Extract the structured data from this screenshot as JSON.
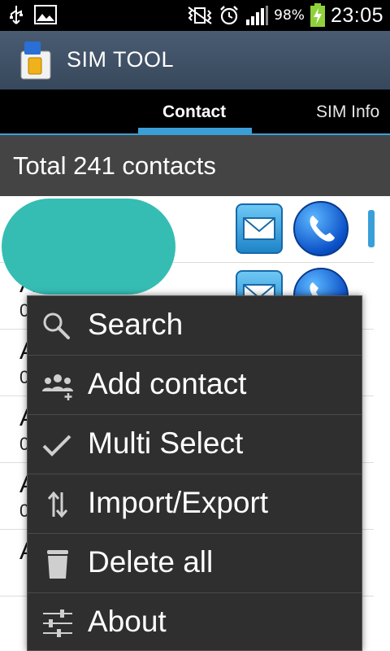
{
  "status_bar": {
    "battery_percent": "98%",
    "time": "23:05"
  },
  "app": {
    "title": "SIM TOOL"
  },
  "tabs": [
    {
      "label": "Contact",
      "selected": true
    },
    {
      "label": "SIM Info",
      "selected": false
    }
  ],
  "contacts": {
    "total_label": "Total 241 contacts",
    "rows": [
      {
        "name": "",
        "number": ""
      },
      {
        "name": "A",
        "number": "0"
      },
      {
        "name": "A",
        "number": "0"
      },
      {
        "name": "A",
        "number": "0"
      },
      {
        "name": "A",
        "number": "0"
      },
      {
        "name": "A",
        "number": ""
      }
    ]
  },
  "menu": {
    "items": [
      {
        "label": "Search",
        "icon": "search-icon"
      },
      {
        "label": "Add contact",
        "icon": "add-contact-icon"
      },
      {
        "label": "Multi Select",
        "icon": "checkmark-icon"
      },
      {
        "label": "Import/Export",
        "icon": "import-export-icon"
      },
      {
        "label": "Delete all",
        "icon": "trash-icon"
      },
      {
        "label": "About",
        "icon": "sliders-icon"
      }
    ]
  },
  "colors": {
    "accent": "#3a9fd8",
    "app_bar": "#4a5c72",
    "header": "#444444",
    "menu_bg": "#2f2f2f",
    "redaction": "#35bdb3"
  }
}
